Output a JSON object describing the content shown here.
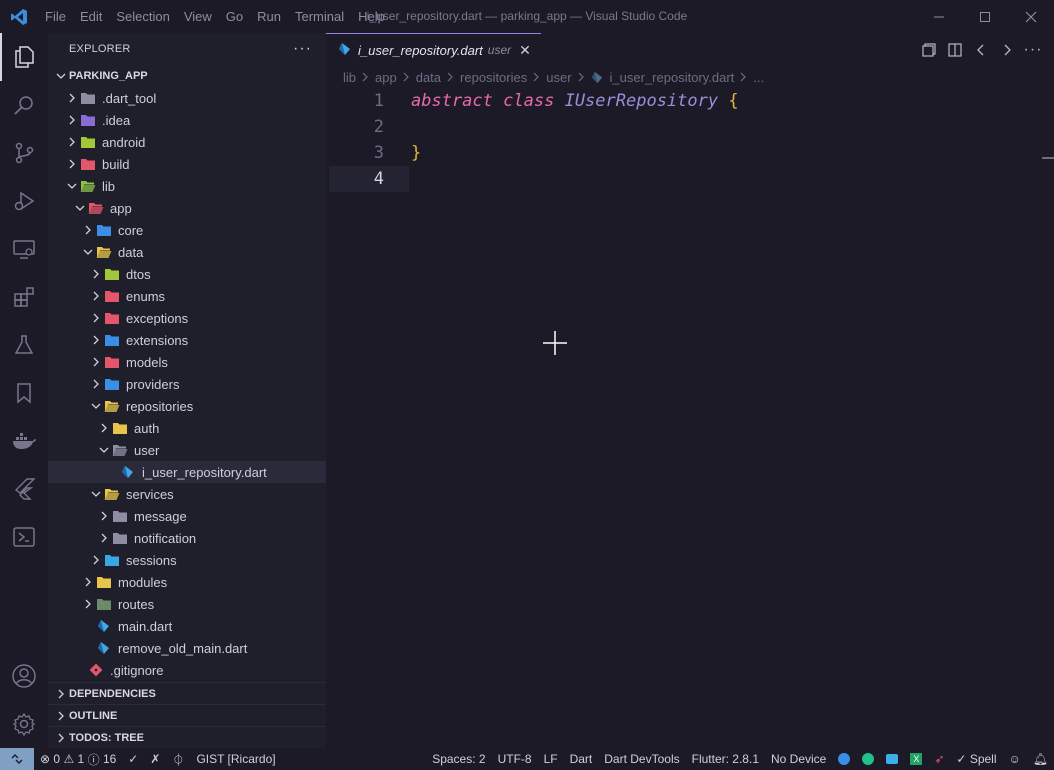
{
  "titlebar": {
    "menu": [
      "File",
      "Edit",
      "Selection",
      "View",
      "Go",
      "Run",
      "Terminal",
      "Help"
    ],
    "title": "i_user_repository.dart — parking_app — Visual Studio Code"
  },
  "explorer": {
    "header": "EXPLORER",
    "project": "PARKING_APP",
    "tree": [
      {
        "label": ".dart_tool",
        "depth": 0,
        "type": "folder",
        "open": false,
        "color": "#8f8da4"
      },
      {
        "label": ".idea",
        "depth": 0,
        "type": "folder",
        "open": false,
        "color": "#8b6bd6"
      },
      {
        "label": "android",
        "depth": 0,
        "type": "folder",
        "open": false,
        "color": "#a4c639"
      },
      {
        "label": "build",
        "depth": 0,
        "type": "folder",
        "open": false,
        "color": "#e5566b"
      },
      {
        "label": "lib",
        "depth": 0,
        "type": "folder",
        "open": true,
        "color": "#8bc34a"
      },
      {
        "label": "app",
        "depth": 1,
        "type": "folder",
        "open": true,
        "color": "#e5566b"
      },
      {
        "label": "core",
        "depth": 2,
        "type": "folder",
        "open": false,
        "color": "#3a8ee6"
      },
      {
        "label": "data",
        "depth": 2,
        "type": "folder",
        "open": true,
        "color": "#e8c54a"
      },
      {
        "label": "dtos",
        "depth": 3,
        "type": "folder",
        "open": false,
        "color": "#a4c639"
      },
      {
        "label": "enums",
        "depth": 3,
        "type": "folder",
        "open": false,
        "color": "#e5566b"
      },
      {
        "label": "exceptions",
        "depth": 3,
        "type": "folder",
        "open": false,
        "color": "#e5566b"
      },
      {
        "label": "extensions",
        "depth": 3,
        "type": "folder",
        "open": false,
        "color": "#3a8ee6"
      },
      {
        "label": "models",
        "depth": 3,
        "type": "folder",
        "open": false,
        "color": "#e5566b"
      },
      {
        "label": "providers",
        "depth": 3,
        "type": "folder",
        "open": false,
        "color": "#3a8ee6"
      },
      {
        "label": "repositories",
        "depth": 3,
        "type": "folder",
        "open": true,
        "color": "#e8c54a"
      },
      {
        "label": "auth",
        "depth": 4,
        "type": "folder",
        "open": false,
        "color": "#e8c54a"
      },
      {
        "label": "user",
        "depth": 4,
        "type": "folder",
        "open": true,
        "color": "#8f8da4"
      },
      {
        "label": "i_user_repository.dart",
        "depth": 5,
        "type": "dart",
        "selected": true
      },
      {
        "label": "services",
        "depth": 3,
        "type": "folder",
        "open": true,
        "color": "#e8c54a"
      },
      {
        "label": "message",
        "depth": 4,
        "type": "folder",
        "open": false,
        "color": "#8f8da4"
      },
      {
        "label": "notification",
        "depth": 4,
        "type": "folder",
        "open": false,
        "color": "#8f8da4"
      },
      {
        "label": "sessions",
        "depth": 3,
        "type": "folder",
        "open": false,
        "color": "#3aa6e6"
      },
      {
        "label": "modules",
        "depth": 2,
        "type": "folder",
        "open": false,
        "color": "#e8c54a"
      },
      {
        "label": "routes",
        "depth": 2,
        "type": "folder",
        "open": false,
        "color": "#6d8a6a"
      },
      {
        "label": "main.dart",
        "depth": 2,
        "type": "dart"
      },
      {
        "label": "remove_old_main.dart",
        "depth": 2,
        "type": "dart"
      },
      {
        "label": ".gitignore",
        "depth": 1,
        "type": "git"
      }
    ],
    "sections": [
      "DEPENDENCIES",
      "OUTLINE",
      "TODOS: TREE"
    ]
  },
  "editor": {
    "tab": {
      "name": "i_user_repository.dart",
      "desc": "user"
    },
    "breadcrumb": [
      "lib",
      "app",
      "data",
      "repositories",
      "user",
      "i_user_repository.dart",
      "..."
    ],
    "lines": [
      {
        "num": "1",
        "tokens": [
          {
            "t": "abstract",
            "c": "kw"
          },
          {
            "t": " ",
            "c": ""
          },
          {
            "t": "class",
            "c": "kw"
          },
          {
            "t": " ",
            "c": ""
          },
          {
            "t": "IUserRepository",
            "c": "cls"
          },
          {
            "t": " ",
            "c": ""
          },
          {
            "t": "{",
            "c": "brace"
          }
        ]
      },
      {
        "num": "2",
        "tokens": []
      },
      {
        "num": "3",
        "tokens": [
          {
            "t": "}",
            "c": "brace"
          }
        ]
      },
      {
        "num": "4",
        "tokens": [],
        "current": true
      }
    ]
  },
  "statusbar": {
    "errors": "0",
    "warnings": "1",
    "infos": "16",
    "gist": "GIST [Ricardo]",
    "spaces": "Spaces: 2",
    "encoding": "UTF-8",
    "eol": "LF",
    "language": "Dart",
    "devtools": "Dart DevTools",
    "flutter": "Flutter: 2.8.1",
    "device": "No Device",
    "spell": "Spell"
  }
}
